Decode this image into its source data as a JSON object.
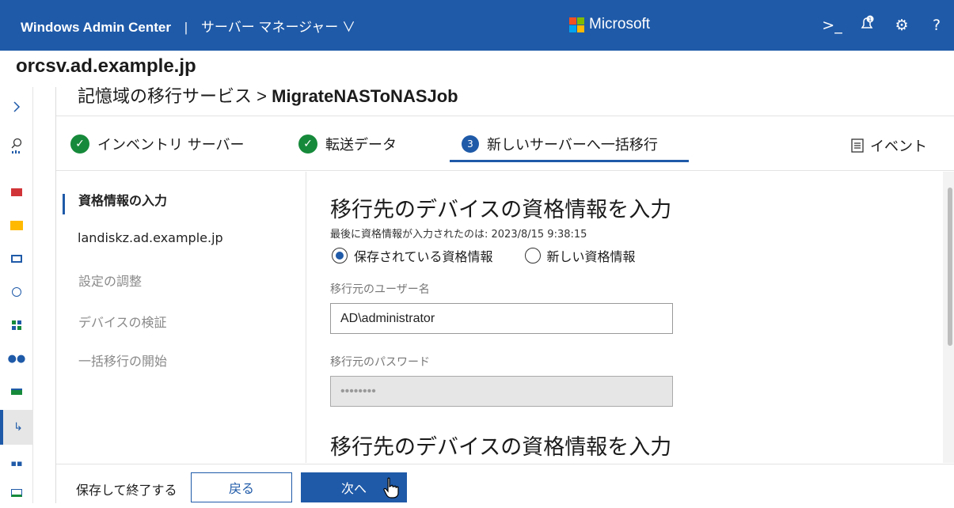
{
  "topbar": {
    "app_name": "Windows Admin Center",
    "separator": "|",
    "tool_menu": "サーバー マネージャー ∨",
    "brand": "Microsoft",
    "icons": [
      "terminal-icon",
      "notification-bell-icon",
      "settings-gear-icon",
      "help-icon"
    ]
  },
  "server_name": "orcsv.ad.example.jp",
  "breadcrumb": {
    "parent": "記憶域の移行サービス",
    "chevron": ">",
    "current": "MigrateNASToNASJob"
  },
  "steps": [
    {
      "label": "インベントリ サーバー",
      "status": "complete"
    },
    {
      "label": "転送データ",
      "status": "complete"
    },
    {
      "number": "3",
      "label": "新しいサーバーへ一括移行",
      "status": "active"
    }
  ],
  "events_label": "イベント",
  "subnav": [
    {
      "label": "資格情報の入力",
      "state": "active"
    },
    {
      "label": "landiskz.ad.example.jp",
      "state": "enabled"
    },
    {
      "label": "設定の調整",
      "state": "disabled"
    },
    {
      "label": "デバイスの検証",
      "state": "disabled"
    },
    {
      "label": "一括移行の開始",
      "state": "disabled"
    }
  ],
  "form": {
    "heading": "移行先のデバイスの資格情報を入力",
    "last_entered": "最後に資格情報が入力されたのは: 2023/8/15 9:38:15",
    "radio_saved": "保存されている資格情報",
    "radio_new": "新しい資格情報",
    "selected_radio": "saved",
    "username_label": "移行元のユーザー名",
    "username_value": "AD\\administrator",
    "password_label": "移行元のパスワード",
    "password_value": "••••••••",
    "heading2": "移行先のデバイスの資格情報を入力"
  },
  "footer": {
    "save_exit": "保存して終了する",
    "back": "戻る",
    "next": "次へ"
  },
  "colors": {
    "accent": "#1f5aa8",
    "success": "#168a3a"
  }
}
